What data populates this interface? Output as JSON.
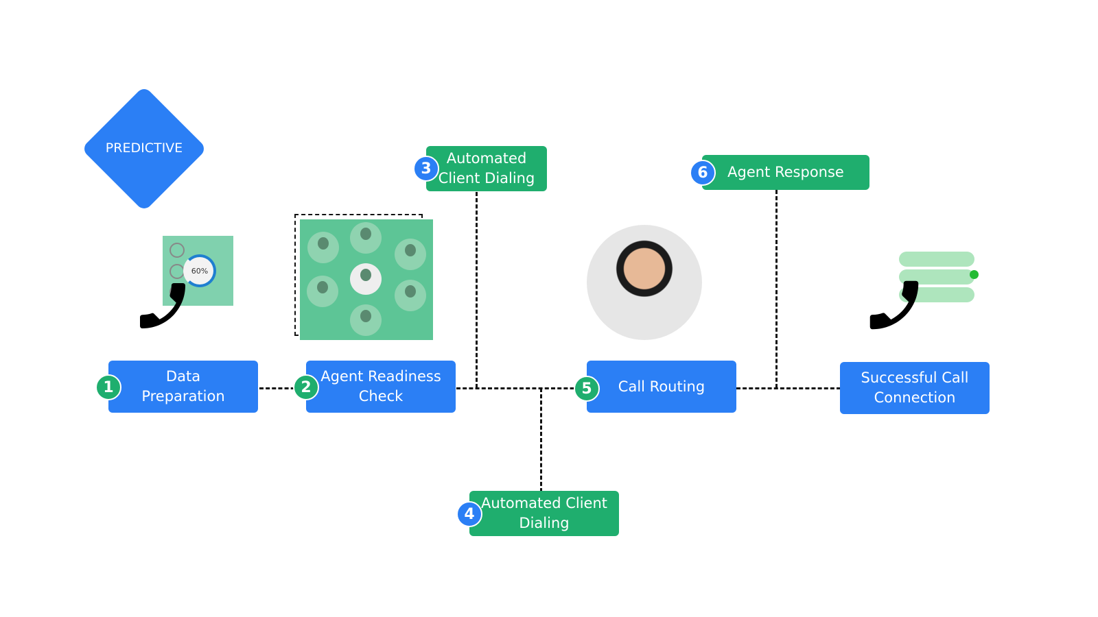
{
  "title": "PREDICTIVE",
  "colors": {
    "blue": "#2b7ff5",
    "green": "#1fae6e"
  },
  "progress": {
    "label": "60%",
    "value": 60
  },
  "steps": [
    {
      "number": "1",
      "label": "Data Preparation"
    },
    {
      "number": "2",
      "label": "Agent Readiness Check"
    },
    {
      "number": "3",
      "label": "Automated Client Dialing"
    },
    {
      "number": "4",
      "label": "Automated Client Dialing"
    },
    {
      "number": "5",
      "label": "Call Routing"
    },
    {
      "number": "6",
      "label": "Agent Response"
    },
    {
      "number": "",
      "label": "Successful Call Connection"
    }
  ],
  "icons": [
    "phone-icon",
    "contact-list-icon",
    "agent-photo",
    "check-icon"
  ]
}
